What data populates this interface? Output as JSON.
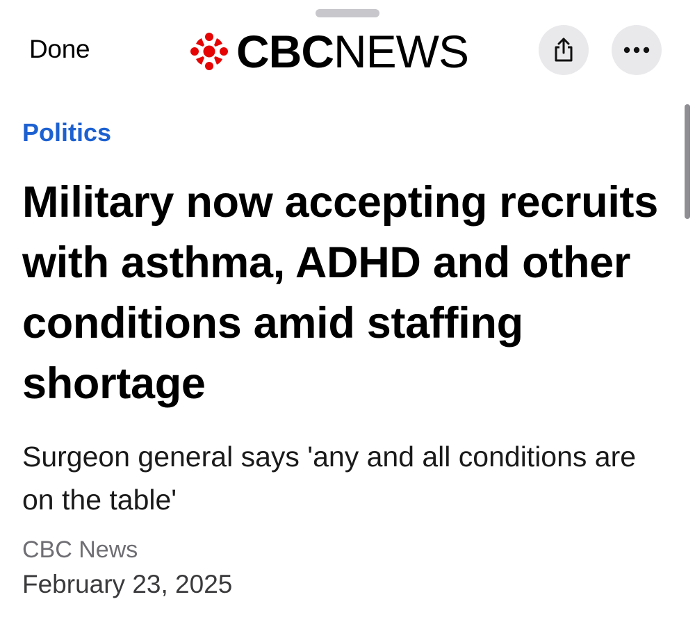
{
  "nav": {
    "done_label": "Done",
    "share_icon": "share-icon",
    "more_icon": "ellipsis-icon"
  },
  "logo": {
    "gem_icon": "cbc-gem-logo",
    "cbc": "CBC",
    "news": "NEWS",
    "color": "#e60505"
  },
  "article": {
    "section": "Politics",
    "section_color": "#1d61d1",
    "headline": "Military now accepting recruits with asthma, ADHD and other conditions amid staffing shortage",
    "deck": "Surgeon general says 'any and all conditions are on the table'",
    "source": "CBC News",
    "date": "February 23, 2025"
  }
}
